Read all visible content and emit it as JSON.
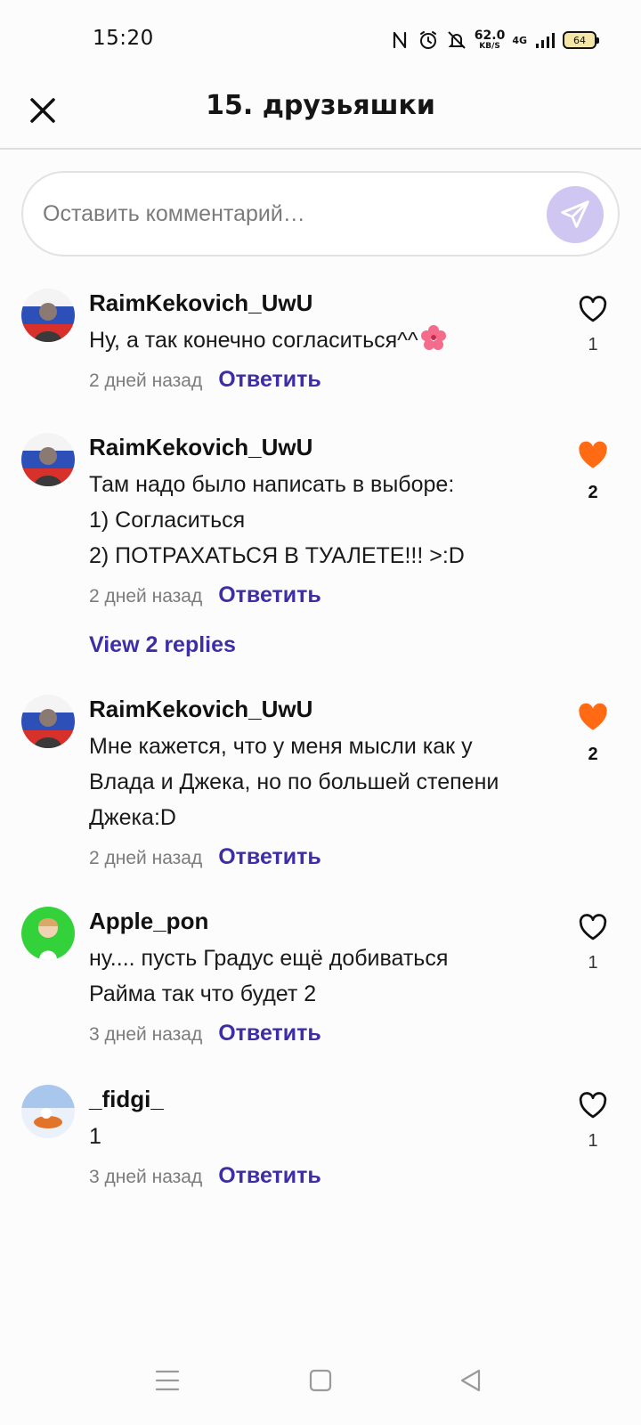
{
  "status_bar": {
    "time": "15:20",
    "net_speed": "62.0",
    "net_speed_unit": "KB/S",
    "net_type": "4G",
    "battery": "64",
    "icons": [
      "nfc-icon",
      "alarm-icon",
      "vibrate-icon",
      "network-speed",
      "signal-icon",
      "battery-icon"
    ]
  },
  "header": {
    "title": "15. друзьяшки",
    "close_icon": "close-icon"
  },
  "composer": {
    "placeholder": "Оставить комментарий…",
    "send_icon": "send-icon"
  },
  "comments": [
    {
      "author": "RaimKekovich_UwU",
      "lines": [
        "Ну, а так конечно согласиться^^"
      ],
      "emoji": "flower-emoji",
      "time": "2 дней назад",
      "reply_label": "Ответить",
      "likes": "1",
      "liked": false
    },
    {
      "author": "RaimKekovich_UwU",
      "lines": [
        "Там надо было написать в выборе:",
        "1) Согласиться",
        "2) ПОТРАХАТЬСЯ В ТУАЛЕТЕ!!! >:D"
      ],
      "time": "2 дней назад",
      "reply_label": "Ответить",
      "likes": "2",
      "liked": true,
      "view_replies": "View 2 replies"
    },
    {
      "author": "RaimKekovich_UwU",
      "lines": [
        "Мне кажется, что у меня мысли как у",
        "Влада и Джека, но по большей степени",
        "Джека:D"
      ],
      "time": "2 дней назад",
      "reply_label": "Ответить",
      "likes": "2",
      "liked": true
    },
    {
      "author": "Apple_pon",
      "lines": [
        "ну.... пусть Градус ещё добиваться",
        "Райма так что будет 2"
      ],
      "time": "3 дней назад",
      "reply_label": "Ответить",
      "likes": "1",
      "liked": false
    },
    {
      "author": "_fidgi_",
      "lines": [
        "1"
      ],
      "time": "3 дней назад",
      "reply_label": "Ответить",
      "likes": "1",
      "liked": false
    }
  ],
  "colors": {
    "accent": "#3d2ea6",
    "like_active": "#ff6a13",
    "send_bg": "#cfc6f2"
  },
  "nav_bar": [
    "menu-icon",
    "home-icon",
    "back-icon"
  ]
}
